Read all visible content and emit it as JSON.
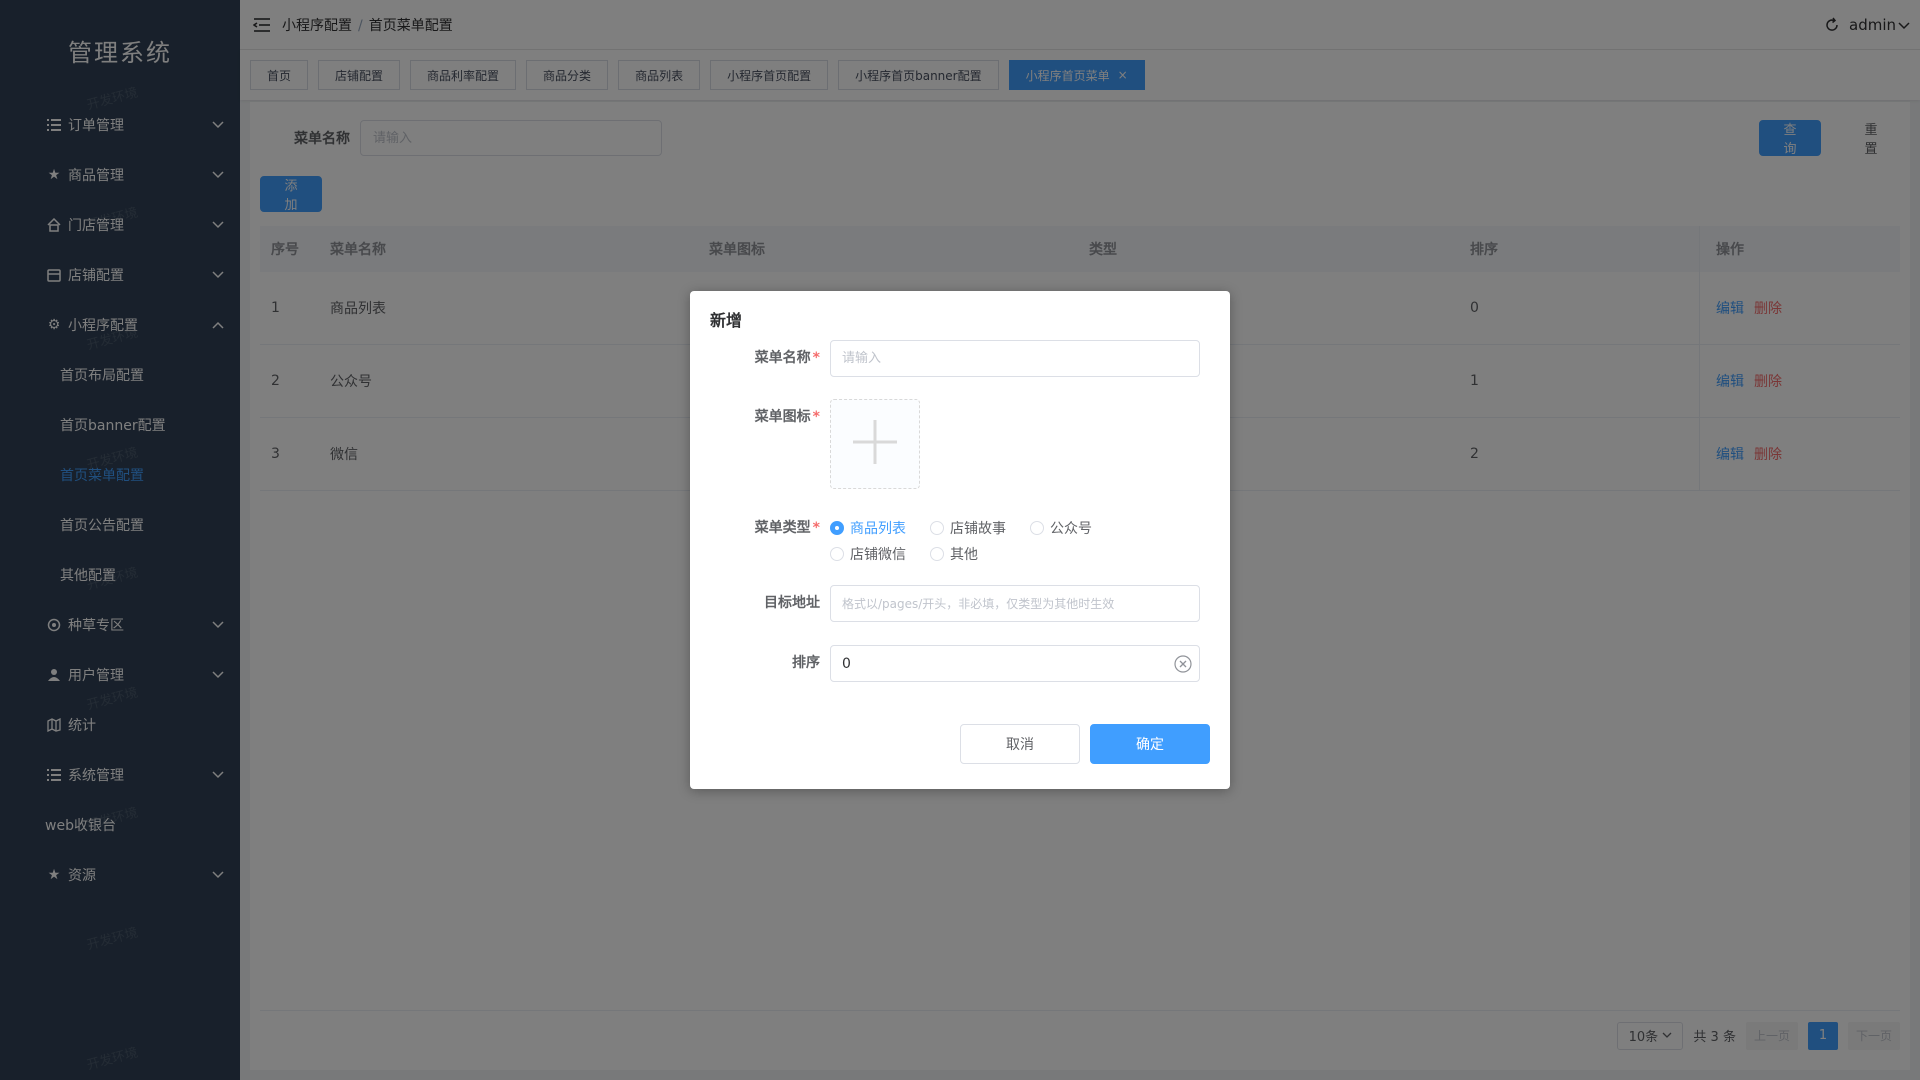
{
  "sidebar": {
    "logo": "管理系统",
    "items": [
      {
        "label": "订单管理",
        "icon": "list-icon"
      },
      {
        "label": "商品管理",
        "icon": "star-icon"
      },
      {
        "label": "门店管理",
        "icon": "home-icon"
      },
      {
        "label": "店铺配置",
        "icon": "shop-icon"
      },
      {
        "label": "小程序配置",
        "icon": "gear-icon"
      },
      {
        "label": "种草专区",
        "icon": "grass-icon"
      },
      {
        "label": "用户管理",
        "icon": "user-icon"
      },
      {
        "label": "统计",
        "icon": "map-icon"
      },
      {
        "label": "系统管理",
        "icon": "list-icon"
      },
      {
        "label": "web收银台",
        "icon": ""
      },
      {
        "label": "资源",
        "icon": "star-icon"
      }
    ],
    "subitems": [
      {
        "label": "首页布局配置"
      },
      {
        "label": "首页banner配置"
      },
      {
        "label": "首页菜单配置"
      },
      {
        "label": "首页公告配置"
      },
      {
        "label": "其他配置"
      }
    ]
  },
  "topbar": {
    "breadcrumb_parent": "小程序配置",
    "breadcrumb_sep": "/",
    "breadcrumb_current": "首页菜单配置",
    "user": "admin"
  },
  "tags": [
    "首页",
    "店铺配置",
    "商品利率配置",
    "商品分类",
    "商品列表",
    "小程序首页配置",
    "小程序首页banner配置",
    "小程序首页菜单"
  ],
  "tag_close": "×",
  "search": {
    "label": "菜单名称",
    "placeholder": "请输入",
    "query_label": "查询",
    "reset_label": "重置",
    "add_label": "添加"
  },
  "table": {
    "headers": [
      "序号",
      "菜单名称",
      "菜单图标",
      "类型",
      "排序",
      "操作"
    ],
    "rows": [
      {
        "seq": "1",
        "name": "商品列表",
        "sort": "0"
      },
      {
        "seq": "2",
        "name": "公众号",
        "sort": "1"
      },
      {
        "seq": "3",
        "name": "微信",
        "sort": "2"
      }
    ],
    "edit_label": "编辑",
    "delete_label": "删除"
  },
  "pager": {
    "page_size": "10条",
    "total": "共 3 条",
    "prev": "上一页",
    "current": "1",
    "next": "下一页"
  },
  "watermark": "开发环境",
  "dialog": {
    "title": "新增",
    "name_label": "菜单名称",
    "name_placeholder": "请输入",
    "icon_label": "菜单图标",
    "type_label": "菜单类型",
    "type_options": [
      "商品列表",
      "店铺故事",
      "公众号",
      "店铺微信",
      "其他"
    ],
    "type_selected": "商品列表",
    "target_label": "目标地址",
    "target_placeholder": "格式以/pages/开头，非必填，仅类型为其他时生效",
    "sort_label": "排序",
    "sort_value": "0",
    "cancel_label": "取消",
    "confirm_label": "确定"
  },
  "colors": {
    "sidebar_bg": "#304156",
    "primary": "#409eff",
    "danger": "#f56c6c"
  }
}
